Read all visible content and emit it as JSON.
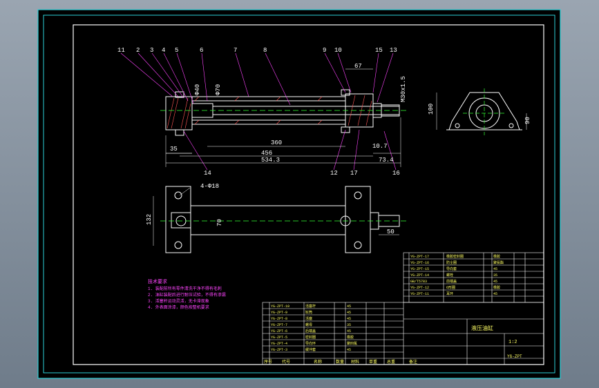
{
  "colors": {
    "background": "#000000",
    "frame_outer": "#2bd1d8",
    "frame_inner": "#ffffff",
    "part": "#ffffff",
    "centerline": "#33ff33",
    "hatch": "#ff5555",
    "dimension": "#ffffff",
    "leader": "#ff44ff",
    "notes": "#ff44ff",
    "table_text": "#ffff66",
    "table_lines": "#ffffff"
  },
  "balloons": [
    "11",
    "2",
    "3",
    "4",
    "5",
    "6",
    "7",
    "8",
    "9",
    "10",
    "15",
    "13",
    "14",
    "12",
    "17",
    "16"
  ],
  "dimensions": {
    "d_67": "67",
    "d_35": "35",
    "d_360": "360",
    "d_456": "456",
    "d_534_3": "534.3",
    "d_10_7": "10.7",
    "d_73_4": "73.4",
    "d_100": "100",
    "d_90": "90",
    "d_132": "132",
    "d_70": "70",
    "d_50": "50",
    "d_holes": "4-Φ18",
    "d_thread": "M30x1.5",
    "d_bore": "Φ70",
    "d_rod": "Φ40"
  },
  "notes_title": "技术要求",
  "notes_lines": [
    "1. 装配前所有零件清洗干净不得有毛刺",
    "2. 油缸装配后进行耐压试验，不得有渗漏",
    "3. 活塞杆运动灵活，无卡滞现象",
    "4. 外表面涂漆，颜色按整机要求"
  ],
  "title_block": {
    "name": "液压油缸",
    "drawing_no": "YG-ZPT",
    "scale": "1:2",
    "header_cells": [
      "序号",
      "代号",
      "名称",
      "数量",
      "材料",
      "单重",
      "总重",
      "备注"
    ]
  }
}
